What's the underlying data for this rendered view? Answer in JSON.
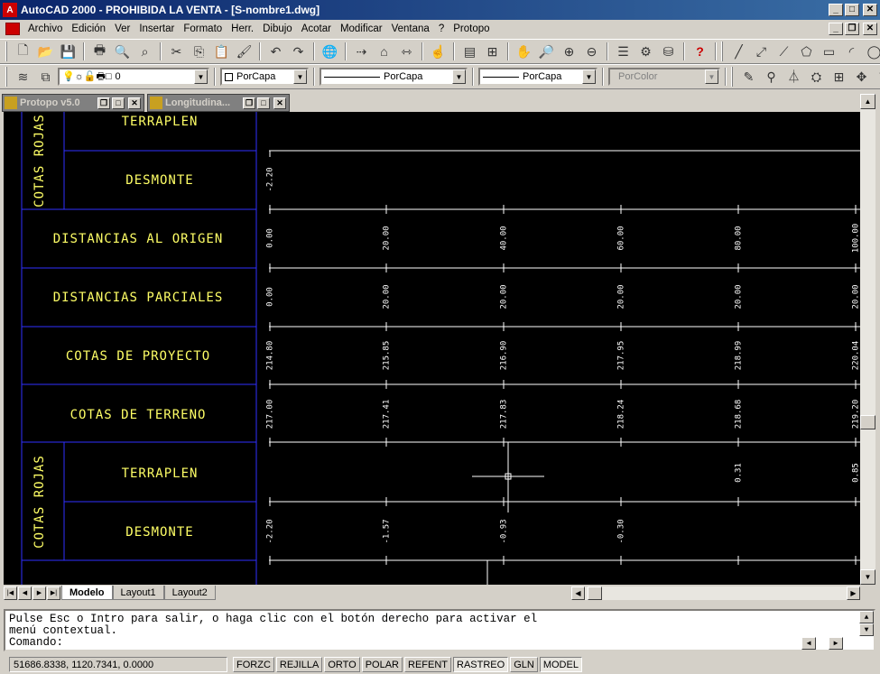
{
  "window": {
    "title": "AutoCAD 2000 - PROHIBIDA LA VENTA - [S-nombre1.dwg]"
  },
  "menu": [
    "Archivo",
    "Edición",
    "Ver",
    "Insertar",
    "Formato",
    "Herr.",
    "Dibujo",
    "Acotar",
    "Modificar",
    "Ventana",
    "?",
    "Protopo"
  ],
  "layers_toolbar": {
    "layer": "0",
    "color": "PorCapa",
    "linetype": "PorCapa",
    "lineweight": "PorCapa",
    "plotstyle": "PorColor"
  },
  "subwindows": [
    {
      "title": "Protopo v5.0"
    },
    {
      "title": "Longitudina..."
    }
  ],
  "profile": {
    "vertical_label": "COTAS ROJAS",
    "rows": {
      "terraplen": "TERRAPLEN",
      "desmonte": "DESMONTE",
      "distancias_origen": "DISTANCIAS AL ORIGEN",
      "distancias_parciales": "DISTANCIAS PARCIALES",
      "cotas_proyecto": "COTAS DE PROYECTO",
      "cotas_terreno": "COTAS DE TERRENO"
    },
    "top_desmonte": [
      "-2.20"
    ],
    "distancias_origen": [
      "0.00",
      "20.00",
      "40.00",
      "60.00",
      "80.00",
      "100.00"
    ],
    "distancias_parciales": [
      "0.00",
      "20.00",
      "20.00",
      "20.00",
      "20.00",
      "20.00"
    ],
    "cotas_proyecto": [
      "214.80",
      "215.85",
      "216.90",
      "217.95",
      "218.99",
      "220.04"
    ],
    "cotas_terreno": [
      "217.00",
      "217.41",
      "217.83",
      "218.24",
      "218.68",
      "219.20"
    ],
    "terraplen": [
      "",
      "",
      "",
      "",
      "0.31",
      "0.85"
    ],
    "desmonte": [
      "-2.20",
      "-1.57",
      "-0.93",
      "-0.30",
      "",
      ""
    ]
  },
  "tabs": [
    {
      "label": "Modelo",
      "active": true
    },
    {
      "label": "Layout1",
      "active": false
    },
    {
      "label": "Layout2",
      "active": false
    }
  ],
  "command": {
    "line1": "Pulse Esc o Intro para salir, o haga clic con el botón derecho para activar el",
    "line2": "menú contextual.",
    "prompt": "Comando:"
  },
  "status": {
    "coords": "51686.8338, 1120.7341, 0.0000",
    "buttons": [
      {
        "label": "FORZC",
        "on": false
      },
      {
        "label": "REJILLA",
        "on": false
      },
      {
        "label": "ORTO",
        "on": false
      },
      {
        "label": "POLAR",
        "on": false
      },
      {
        "label": "REFENT",
        "on": false
      },
      {
        "label": "RASTREO",
        "on": true
      },
      {
        "label": "GLN",
        "on": false
      },
      {
        "label": "MODEL",
        "on": true
      }
    ]
  },
  "colors": {
    "label_yellow": "#ffff66",
    "frame_blue": "#3030ff",
    "canvas": "#000000"
  }
}
